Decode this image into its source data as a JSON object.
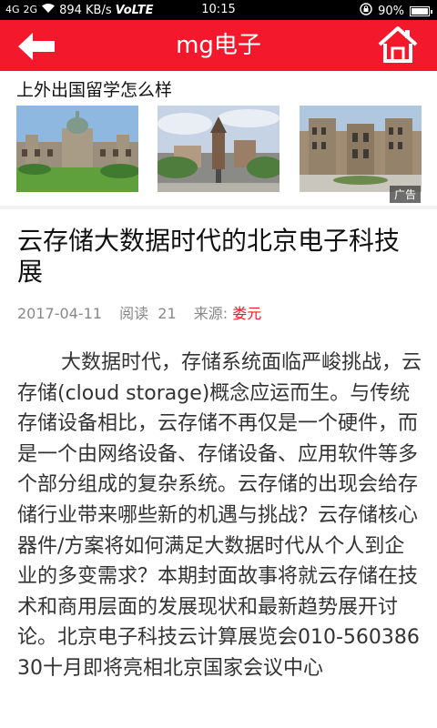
{
  "status_bar": {
    "signal": "4G",
    "signal2": "2G",
    "speed": "894 KB/s",
    "volte": "VoLTE",
    "time": "10:15",
    "battery": "90%",
    "battery_level": 0.9
  },
  "app_bar": {
    "title": "mg电子",
    "back_icon": "arrow-left-icon",
    "home_icon": "home-icon"
  },
  "ad": {
    "title": "上外出国留学怎么样",
    "badge": "广告",
    "images": [
      {
        "name": "ad-image-parliament"
      },
      {
        "name": "ad-image-square"
      },
      {
        "name": "ad-image-building"
      }
    ]
  },
  "article": {
    "title": "云存储大数据时代的北京电子科技展",
    "date": "2017-04-11",
    "read_label": "阅读",
    "read_count": "21",
    "source_label": "来源:",
    "source_value": "娄元",
    "body": "大数据时代，存储系统面临严峻挑战，云存储(cloud storage)概念应运而生。与传统存储设备相比，云存储不再仅是一个硬件，而是一个由网络设备、存储设备、应用软件等多个部分组成的复杂系统。云存储的出现会给存储行业带来哪些新的机遇与挑战？云存储核心器件/方案将如何满足大数据时代从个人到企业的多变需求？本期封面故事将就云存储在技术和商用层面的发展现状和最新趋势展开讨论。北京电子科技云计算展览会010-56038630十月即将亮相北京国家会议中心"
  }
}
